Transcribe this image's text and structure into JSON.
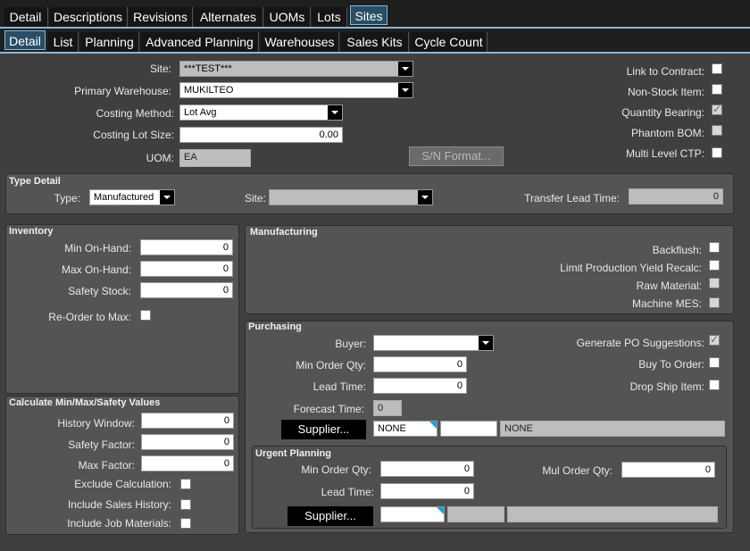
{
  "tabs_top": [
    "Detail",
    "Descriptions",
    "Revisions",
    "Alternates",
    "UOMs",
    "Lots",
    "Sites"
  ],
  "tabs_sub": [
    "Detail",
    "List",
    "Planning",
    "Advanced Planning",
    "Warehouses",
    "Sales Kits",
    "Cycle Count"
  ],
  "header": {
    "site_label": "Site:",
    "site_value": "***TEST***",
    "primary_wh_label": "Primary Warehouse:",
    "primary_wh_value": "MUKILTEO",
    "costing_method_label": "Costing Method:",
    "costing_method_value": "Lot Avg",
    "costing_lot_size_label": "Costing Lot Size:",
    "costing_lot_size_value": "0.00",
    "uom_label": "UOM:",
    "uom_value": "EA",
    "sn_format_button": "S/N Format...",
    "link_to_contract": "Link to Contract:",
    "non_stock_item": "Non-Stock Item:",
    "quantity_bearing": "Quantity Bearing:",
    "phantom_bom": "Phantom BOM:",
    "multi_level_ctp": "Multi Level CTP:"
  },
  "type_detail": {
    "title": "Type Detail",
    "type_label": "Type:",
    "type_value": "Manufactured",
    "site_label": "Site:",
    "site_value": "",
    "transfer_lead_label": "Transfer Lead Time:",
    "transfer_lead_value": "0"
  },
  "inventory": {
    "title": "Inventory",
    "min_label": "Min On-Hand:",
    "min_value": "0",
    "max_label": "Max On-Hand:",
    "max_value": "0",
    "safety_label": "Safety Stock:",
    "safety_value": "0",
    "reorder_label": "Re-Order to Max:"
  },
  "calc": {
    "title": "Calculate Min/Max/Safety Values",
    "history_label": "History Window:",
    "history_value": "0",
    "safety_factor_label": "Safety Factor:",
    "safety_factor_value": "0",
    "max_factor_label": "Max Factor:",
    "max_factor_value": "0",
    "exclude_label": "Exclude Calculation:",
    "include_sales_label": "Include Sales History:",
    "include_job_label": "Include Job Materials:"
  },
  "manufacturing": {
    "title": "Manufacturing",
    "backflush": "Backflush:",
    "limit_yield": "Limit Production Yield Recalc:",
    "raw_material": "Raw Material:",
    "machine_mes": "Machine MES:"
  },
  "purchasing": {
    "title": "Purchasing",
    "buyer_label": "Buyer:",
    "buyer_value": "",
    "min_order_label": "Min Order Qty:",
    "min_order_value": "0",
    "lead_time_label": "Lead Time:",
    "lead_time_value": "0",
    "forecast_label": "Forecast Time:",
    "forecast_value": "0",
    "supplier_button": "Supplier...",
    "supplier_id": "NONE",
    "supplier_name": "NONE",
    "generate_po": "Generate PO Suggestions:",
    "buy_to_order": "Buy To Order:",
    "drop_ship": "Drop Ship Item:"
  },
  "urgent": {
    "title": "Urgent Planning",
    "min_order_label": "Min Order Qty:",
    "min_order_value": "0",
    "lead_time_label": "Lead Time:",
    "lead_time_value": "0",
    "mul_order_label": "Mul Order Qty:",
    "mul_order_value": "0",
    "supplier_button": "Supplier..."
  }
}
